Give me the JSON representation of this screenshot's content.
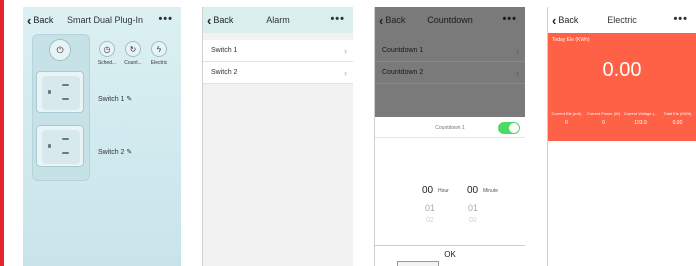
{
  "screen1": {
    "back_label": "Back",
    "title": "Smart Dual Plug-In",
    "more": "•••",
    "power_icon": "power-icon",
    "functions": [
      {
        "icon": "clock-icon",
        "glyph": "◷",
        "label": "Sched..."
      },
      {
        "icon": "countdown-icon",
        "glyph": "↻",
        "label": "Count..."
      },
      {
        "icon": "lightning-icon",
        "glyph": "ϟ",
        "label": "Electric"
      }
    ],
    "switch1_label": "Switch 1 ✎",
    "switch2_label": "Switch 2 ✎"
  },
  "screen2": {
    "back_label": "Back",
    "title": "Alarm",
    "more": "•••",
    "rows": [
      "Switch 1",
      "Switch 2"
    ]
  },
  "screen3": {
    "back_label": "Back",
    "title": "Countdown",
    "more": "•••",
    "rows": [
      "Countdown 1",
      "Countdown 2"
    ],
    "countdown_row_label": "Countdown 1",
    "toggle_on": true,
    "hour_value": "00",
    "hour_unit": "Hour",
    "minute_value": "00",
    "minute_unit": "Minute",
    "hour_next": "01",
    "minute_next": "01",
    "hour_next2": "02",
    "minute_next2": "02",
    "ok_label": "OK"
  },
  "screen4": {
    "back_label": "Back",
    "title": "Electric",
    "more": "•••",
    "today_label": "Today Ele (KWh)",
    "today_value": "0.00",
    "stats": [
      {
        "label": "Current Ele (mA)",
        "value": "0"
      },
      {
        "label": "Current Power (W)",
        "value": "0"
      },
      {
        "label": "Current Voltage (...",
        "value": "103.9"
      },
      {
        "label": "Total Ele (KWh)",
        "value": "0.00"
      }
    ],
    "accent": "#ff6146"
  }
}
